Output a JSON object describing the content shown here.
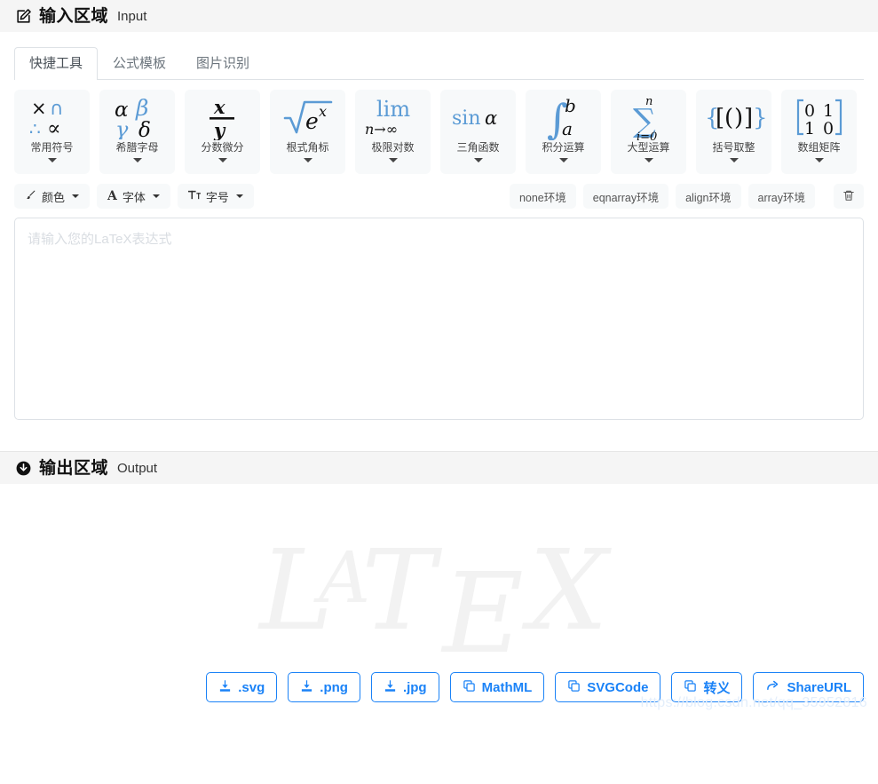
{
  "input_section": {
    "icon": "edit-square-icon",
    "title_cn": "输入区域",
    "title_en": "Input",
    "tabs": [
      {
        "label": "快捷工具",
        "active": true
      },
      {
        "label": "公式模板",
        "active": false
      },
      {
        "label": "图片识别",
        "active": false
      }
    ],
    "palette": [
      {
        "label": "常用符号",
        "glyph": "times-cap-therefore-propto"
      },
      {
        "label": "希腊字母",
        "glyph": "alpha-beta-gamma-delta"
      },
      {
        "label": "分数微分",
        "glyph": "x-over-y-fraction"
      },
      {
        "label": "根式角标",
        "glyph": "sqrt-e-to-x"
      },
      {
        "label": "极限对数",
        "glyph": "lim-n-to-infinity"
      },
      {
        "label": "三角函数",
        "glyph": "sin-alpha"
      },
      {
        "label": "积分运算",
        "glyph": "integral-a-to-b"
      },
      {
        "label": "大型运算",
        "glyph": "sum-i-0-to-n"
      },
      {
        "label": "括号取整",
        "glyph": "brace-bracket-paren"
      },
      {
        "label": "数组矩阵",
        "glyph": "matrix-0-1-1-0"
      }
    ],
    "matrix": {
      "r0c0": "0",
      "r0c1": "1",
      "r1c0": "1",
      "r1c1": "0"
    },
    "sum_top": "n",
    "sum_bottom": "i=0",
    "lim_text": "lim",
    "lim_sub": "n→∞",
    "sin_text": "sin",
    "sin_arg": "α",
    "sqrt_base": "e",
    "sqrt_exp": "x",
    "frac_num": "x",
    "frac_den": "y",
    "integral_upper": "b",
    "integral_lower": "a",
    "brackets_text": "{[()]}",
    "greek": {
      "alpha": "α",
      "beta": "β",
      "gamma": "γ",
      "delta": "δ"
    },
    "common": {
      "times": "×",
      "cap": "∩",
      "therefore": "∴",
      "propto": "∝"
    },
    "toolbar": {
      "color_label": "颜色",
      "color_icon": "brush-icon",
      "font_label": "字体",
      "font_icon": "letter-a-icon",
      "size_label": "字号",
      "size_icon": "text-size-icon",
      "environments": [
        "none环境",
        "eqnarray环境",
        "align环境",
        "array环境"
      ],
      "clear_icon": "trash-icon"
    },
    "editor": {
      "placeholder": "请输入您的LaTeX表达式",
      "value": ""
    }
  },
  "output_section": {
    "icon": "download-circle-icon",
    "title_cn": "输出区域",
    "title_en": "Output",
    "watermark": {
      "l": "L",
      "a": "A",
      "t": "T",
      "e": "E",
      "x": "X"
    },
    "export_buttons": [
      {
        "label": ".svg",
        "icon": "download-icon"
      },
      {
        "label": ".png",
        "icon": "download-icon"
      },
      {
        "label": ".jpg",
        "icon": "download-icon"
      },
      {
        "label": "MathML",
        "icon": "copy-icon"
      },
      {
        "label": "SVGCode",
        "icon": "copy-icon"
      },
      {
        "label": "转义",
        "icon": "copy-icon"
      },
      {
        "label": "ShareURL",
        "icon": "share-arrow-icon"
      }
    ]
  },
  "page_watermark": "https://blog.csdn.net/qq_35952816",
  "colors": {
    "accent_blue": "#5b9bd5",
    "button_blue": "#1a82f7",
    "header_bg": "#f5f5f5",
    "card_bg": "#f7f9fa"
  }
}
